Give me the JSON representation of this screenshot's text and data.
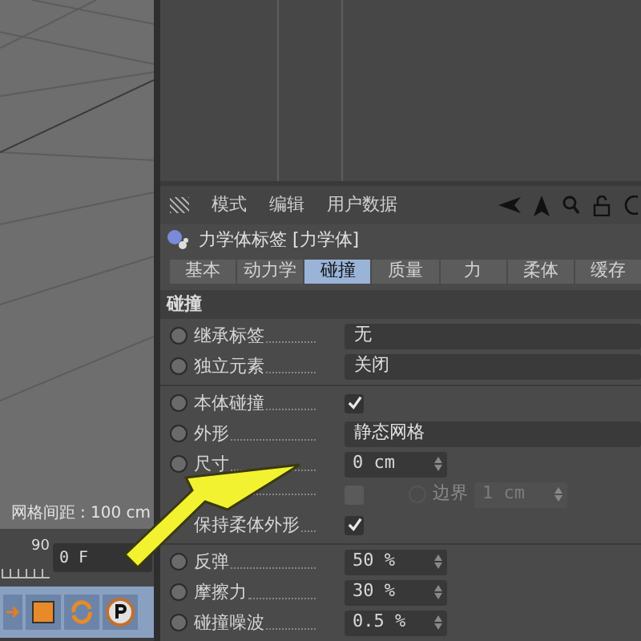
{
  "viewport": {
    "grid_label": "网格间距 : 100 cm"
  },
  "timeline": {
    "tick": "90",
    "frame": "0 F"
  },
  "menu": [
    "模式",
    "编辑",
    "用户数据"
  ],
  "object": {
    "title": "力学体标签 [力学体]"
  },
  "tabs": [
    {
      "label": "基本",
      "selected": false
    },
    {
      "label": "动力学",
      "selected": false
    },
    {
      "label": "碰撞",
      "selected": true
    },
    {
      "label": "质量",
      "selected": false
    },
    {
      "label": "力",
      "selected": false
    },
    {
      "label": "柔体",
      "selected": false
    },
    {
      "label": "缓存",
      "selected": false
    }
  ],
  "section": "碰撞",
  "groups": [
    [
      {
        "kind": "dropdown",
        "label": "继承标签",
        "value": "无",
        "keyframe": false
      },
      {
        "kind": "dropdown",
        "label": "独立元素",
        "value": "关闭",
        "keyframe": false
      }
    ],
    [
      {
        "kind": "checkbox",
        "label": "本体碰撞",
        "checked": true,
        "disabled": false,
        "keyframe": false
      },
      {
        "kind": "dropdown",
        "label": "外形",
        "value": "静态网格",
        "keyframe": false
      },
      {
        "kind": "number",
        "label": "尺寸",
        "value": "0 cm",
        "keyframe": false
      },
      {
        "kind": "checkbox_extra",
        "checked": false,
        "disabled": true,
        "extra_label": "边界",
        "extra_value": "1 cm",
        "extra_keyframe": false
      },
      {
        "kind": "checkbox",
        "label": "保持柔体外形",
        "checked": true,
        "disabled": false
      }
    ],
    [
      {
        "kind": "number",
        "label": "反弹",
        "value": "50 %",
        "keyframe": false
      },
      {
        "kind": "number",
        "label": "摩擦力",
        "value": "30 %",
        "keyframe": false
      },
      {
        "kind": "number",
        "label": "碰撞噪波",
        "value": "0.5 %",
        "keyframe": false
      }
    ]
  ]
}
